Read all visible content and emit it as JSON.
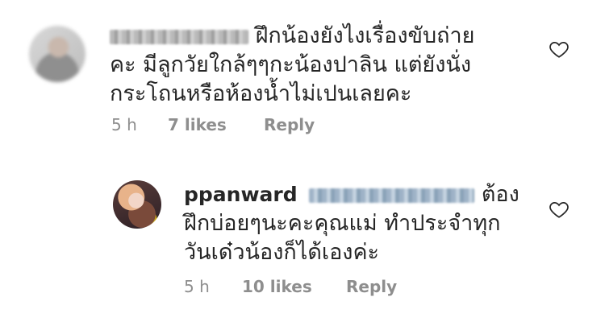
{
  "comments": [
    {
      "username": "",
      "text_lines": [
        "ฝึกน้องยังไงเรื่องขับถ่าย",
        "คะ มีลูกวัยใกล้ๆๆกะน้องปาลิน แต่ยังนั่ง",
        "กระโถนหรือห้องน้ำไม่เปนเลยคะ"
      ],
      "time": "5 h",
      "likes": "7 likes",
      "reply": "Reply",
      "icons": {
        "like": "heart-outline-icon"
      }
    },
    {
      "username": "ppanward",
      "text_lines": [
        "ต้อง",
        "ฝึกบ่อยๆนะคะคุณแม่ ทำประจำทุก",
        "วันเด๋วน้องก็ได้เองค่ะ"
      ],
      "time": "5 h",
      "likes": "10 likes",
      "reply": "Reply",
      "icons": {
        "like": "heart-outline-icon"
      }
    }
  ]
}
